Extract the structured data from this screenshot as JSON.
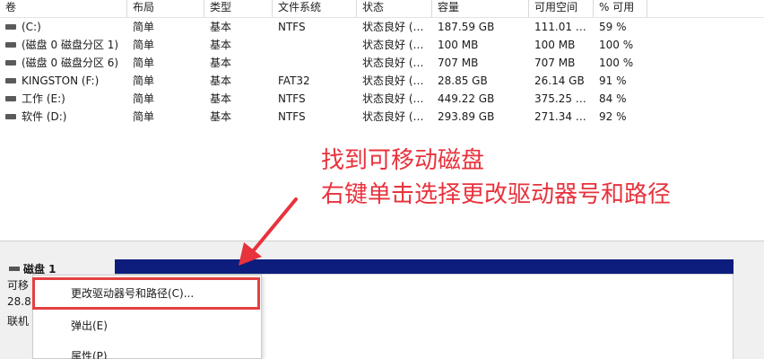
{
  "columns": [
    "卷",
    "布局",
    "类型",
    "文件系统",
    "状态",
    "容量",
    "可用空间",
    "% 可用"
  ],
  "volumes": [
    {
      "name": "(C:)",
      "layout": "简单",
      "type": "基本",
      "fs": "NTFS",
      "status": "状态良好 (…",
      "capacity": "187.59 GB",
      "free": "111.01 …",
      "pct": "59 %"
    },
    {
      "name": "(磁盘 0 磁盘分区 1)",
      "layout": "简单",
      "type": "基本",
      "fs": "",
      "status": "状态良好 (…",
      "capacity": "100 MB",
      "free": "100 MB",
      "pct": "100 %"
    },
    {
      "name": "(磁盘 0 磁盘分区 6)",
      "layout": "简单",
      "type": "基本",
      "fs": "",
      "status": "状态良好 (…",
      "capacity": "707 MB",
      "free": "707 MB",
      "pct": "100 %"
    },
    {
      "name": "KINGSTON (F:)",
      "layout": "简单",
      "type": "基本",
      "fs": "FAT32",
      "status": "状态良好 (…",
      "capacity": "28.85 GB",
      "free": "26.14 GB",
      "pct": "91 %"
    },
    {
      "name": "工作 (E:)",
      "layout": "简单",
      "type": "基本",
      "fs": "NTFS",
      "status": "状态良好 (…",
      "capacity": "449.22 GB",
      "free": "375.25 …",
      "pct": "84 %"
    },
    {
      "name": "软件 (D:)",
      "layout": "简单",
      "type": "基本",
      "fs": "NTFS",
      "status": "状态良好 (…",
      "capacity": "293.89 GB",
      "free": "271.34 …",
      "pct": "92 %"
    }
  ],
  "annotation": {
    "line1": "找到可移动磁盘",
    "line2": "右键单击选择更改驱动器号和路径",
    "color": "#e8323c"
  },
  "disk": {
    "title": "磁盘 1",
    "line1": "可移",
    "line2": "28.8",
    "line3": "联机"
  },
  "context_menu": {
    "items": [
      "更改驱动器号和路径(C)...",
      "弹出(E)",
      "属性(P)"
    ]
  },
  "colors": {
    "partition_bar": "#0c1d7d",
    "highlight": "#e34040"
  }
}
